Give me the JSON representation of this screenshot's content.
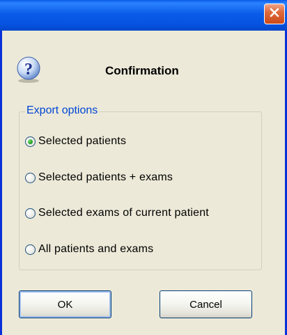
{
  "window": {
    "close_icon": "close-icon"
  },
  "header": {
    "icon": "question-icon",
    "title": "Confirmation"
  },
  "export_options": {
    "legend": "Export options",
    "selected_index": 0,
    "options": [
      {
        "label": "Selected patients"
      },
      {
        "label": "Selected patients + exams"
      },
      {
        "label": "Selected exams of current patient"
      },
      {
        "label": "All patients and exams"
      }
    ]
  },
  "buttons": {
    "ok_label": "OK",
    "cancel_label": "Cancel"
  },
  "colors": {
    "titlebar": "#0553e0",
    "legend_text": "#0046d5",
    "close_button": "#cc4a1a"
  }
}
